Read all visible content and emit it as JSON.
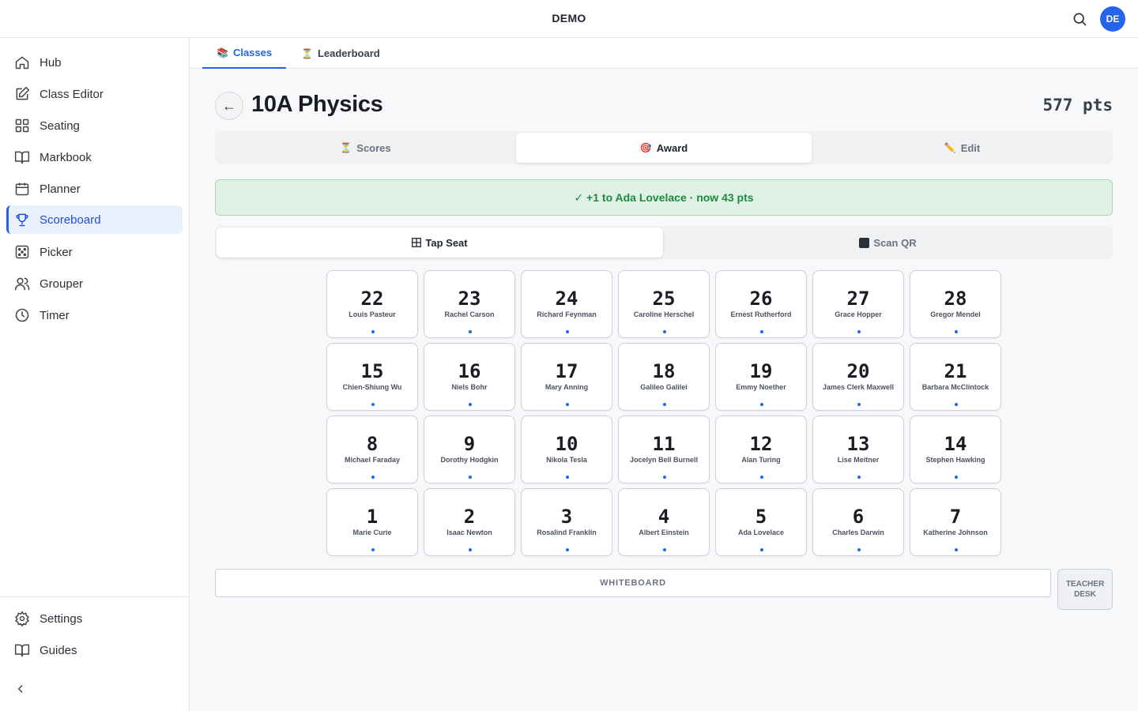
{
  "app": {
    "title": "DEMO",
    "avatar_initials": "DE",
    "accent": "#2563eb"
  },
  "sidebar": {
    "items": [
      {
        "label": "Hub",
        "icon": "home-icon"
      },
      {
        "label": "Class Editor",
        "icon": "edit-icon"
      },
      {
        "label": "Seating",
        "icon": "grid-icon"
      },
      {
        "label": "Markbook",
        "icon": "book-icon"
      },
      {
        "label": "Planner",
        "icon": "calendar-icon"
      },
      {
        "label": "Scoreboard",
        "icon": "trophy-icon",
        "active": true
      },
      {
        "label": "Picker",
        "icon": "dice-icon"
      },
      {
        "label": "Grouper",
        "icon": "users-icon"
      },
      {
        "label": "Timer",
        "icon": "clock-icon"
      }
    ],
    "footer_items": [
      {
        "label": "Settings",
        "icon": "gear-icon"
      },
      {
        "label": "Guides",
        "icon": "book-icon"
      }
    ]
  },
  "main_tabs": [
    {
      "label": "Classes",
      "icon": "📚",
      "active": true
    },
    {
      "label": "Leaderboard",
      "icon": "⏳"
    }
  ],
  "header": {
    "class_name": "10A Physics",
    "total_points": "577 pts"
  },
  "segments": [
    {
      "label": "Scores",
      "icon": "⏳"
    },
    {
      "label": "Award",
      "icon": "🎯",
      "active": true
    },
    {
      "label": "Edit",
      "icon": "✏️"
    }
  ],
  "banner": {
    "text": "✓ +1 to Ada Lovelace · now 43 pts",
    "color": "#1f8a3f"
  },
  "modes": [
    {
      "label": "Tap Seat",
      "icon": "grid-icon",
      "active": true
    },
    {
      "label": "Scan QR",
      "icon": "square-icon"
    }
  ],
  "seats": [
    {
      "num": "22",
      "name": "Louis Pasteur"
    },
    {
      "num": "23",
      "name": "Rachel Carson"
    },
    {
      "num": "24",
      "name": "Richard Feynman"
    },
    {
      "num": "25",
      "name": "Caroline Herschel"
    },
    {
      "num": "26",
      "name": "Ernest Rutherford"
    },
    {
      "num": "27",
      "name": "Grace Hopper"
    },
    {
      "num": "28",
      "name": "Gregor Mendel"
    },
    {
      "num": "15",
      "name": "Chien-Shiung Wu"
    },
    {
      "num": "16",
      "name": "Niels Bohr"
    },
    {
      "num": "17",
      "name": "Mary Anning"
    },
    {
      "num": "18",
      "name": "Galileo Galilei"
    },
    {
      "num": "19",
      "name": "Emmy Noether"
    },
    {
      "num": "20",
      "name": "James Clerk Maxwell"
    },
    {
      "num": "21",
      "name": "Barbara McClintock"
    },
    {
      "num": "8",
      "name": "Michael Faraday"
    },
    {
      "num": "9",
      "name": "Dorothy Hodgkin"
    },
    {
      "num": "10",
      "name": "Nikola Tesla"
    },
    {
      "num": "11",
      "name": "Jocelyn Bell Burnell"
    },
    {
      "num": "12",
      "name": "Alan Turing"
    },
    {
      "num": "13",
      "name": "Lise Meitner"
    },
    {
      "num": "14",
      "name": "Stephen Hawking"
    },
    {
      "num": "1",
      "name": "Marie Curie"
    },
    {
      "num": "2",
      "name": "Isaac Newton"
    },
    {
      "num": "3",
      "name": "Rosalind Franklin"
    },
    {
      "num": "4",
      "name": "Albert Einstein"
    },
    {
      "num": "5",
      "name": "Ada Lovelace"
    },
    {
      "num": "6",
      "name": "Charles Darwin"
    },
    {
      "num": "7",
      "name": "Katherine Johnson"
    }
  ],
  "room": {
    "whiteboard_label": "WHITEBOARD",
    "desk_line1": "TEACHER",
    "desk_line2": "DESK"
  }
}
